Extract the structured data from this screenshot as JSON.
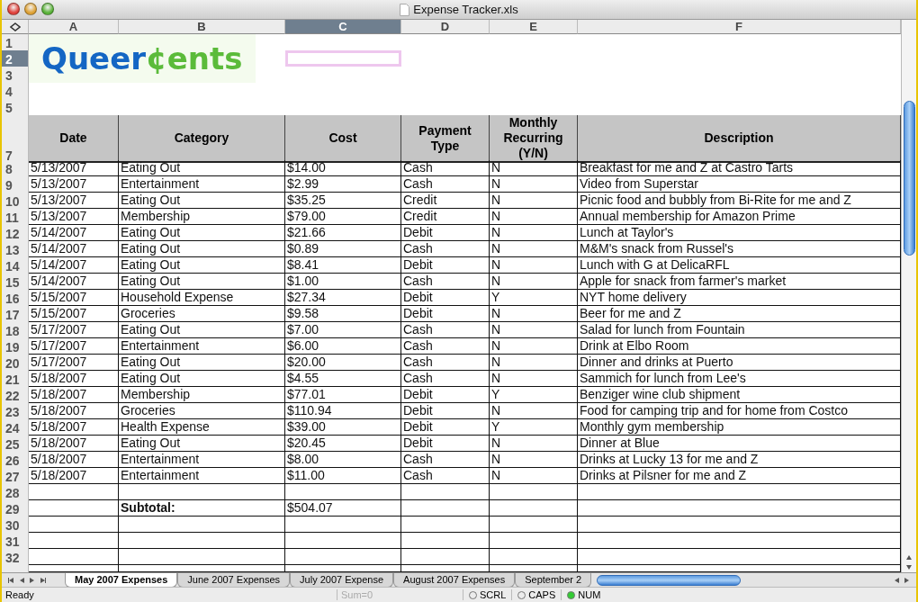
{
  "window": {
    "title": "Expense Tracker.xls"
  },
  "columns": [
    {
      "label": "A",
      "selected": false
    },
    {
      "label": "B",
      "selected": false
    },
    {
      "label": "C",
      "selected": true
    },
    {
      "label": "D",
      "selected": false
    },
    {
      "label": "E",
      "selected": false
    },
    {
      "label": "F",
      "selected": false
    }
  ],
  "logo": {
    "text_1": "Queer",
    "text_2": "¢ents"
  },
  "top_rows": [
    {
      "label": "1",
      "selected": false
    },
    {
      "label": "2",
      "selected": true
    },
    {
      "label": "3",
      "selected": false
    },
    {
      "label": "4",
      "selected": false
    },
    {
      "label": "5",
      "selected": false
    }
  ],
  "header_row": {
    "label": "7",
    "cells": [
      "Date",
      "Category",
      "Cost",
      "Payment Type",
      "Monthly Recurring (Y/N)",
      "Description"
    ]
  },
  "rows": [
    {
      "label": "8",
      "kind": "data",
      "cells": [
        "5/13/2007",
        "Eating Out",
        "$14.00",
        "Cash",
        "N",
        "Breakfast for me and Z at Castro Tarts"
      ]
    },
    {
      "label": "9",
      "kind": "data",
      "cells": [
        "5/13/2007",
        "Entertainment",
        "$2.99",
        "Cash",
        "N",
        "Video from Superstar"
      ]
    },
    {
      "label": "10",
      "kind": "data",
      "cells": [
        "5/13/2007",
        "Eating Out",
        "$35.25",
        "Credit",
        "N",
        "Picnic food and bubbly from Bi-Rite for me and Z"
      ]
    },
    {
      "label": "11",
      "kind": "data",
      "cells": [
        "5/13/2007",
        "Membership",
        "$79.00",
        "Credit",
        "N",
        "Annual membership for Amazon Prime"
      ]
    },
    {
      "label": "12",
      "kind": "data",
      "cells": [
        "5/14/2007",
        "Eating Out",
        "$21.66",
        "Debit",
        "N",
        "Lunch at Taylor's"
      ]
    },
    {
      "label": "13",
      "kind": "data",
      "cells": [
        "5/14/2007",
        "Eating Out",
        "$0.89",
        "Cash",
        "N",
        "M&M's snack from Russel's"
      ]
    },
    {
      "label": "14",
      "kind": "data",
      "cells": [
        "5/14/2007",
        "Eating Out",
        "$8.41",
        "Debit",
        "N",
        "Lunch with G at DelicaRFL"
      ]
    },
    {
      "label": "15",
      "kind": "data",
      "cells": [
        "5/14/2007",
        "Eating Out",
        "$1.00",
        "Cash",
        "N",
        "Apple for snack from farmer's market"
      ]
    },
    {
      "label": "16",
      "kind": "data",
      "cells": [
        "5/15/2007",
        "Household Expense",
        "$27.34",
        "Debit",
        "Y",
        "NYT home delivery"
      ]
    },
    {
      "label": "17",
      "kind": "data",
      "cells": [
        "5/15/2007",
        "Groceries",
        "$9.58",
        "Debit",
        "N",
        "Beer for me and Z"
      ]
    },
    {
      "label": "18",
      "kind": "data",
      "cells": [
        "5/17/2007",
        "Eating Out",
        "$7.00",
        "Cash",
        "N",
        "Salad for lunch from Fountain"
      ]
    },
    {
      "label": "19",
      "kind": "data",
      "cells": [
        "5/17/2007",
        "Entertainment",
        "$6.00",
        "Cash",
        "N",
        "Drink at Elbo Room"
      ]
    },
    {
      "label": "20",
      "kind": "data",
      "cells": [
        "5/17/2007",
        "Eating Out",
        "$20.00",
        "Cash",
        "N",
        "Dinner and drinks at Puerto"
      ]
    },
    {
      "label": "21",
      "kind": "data",
      "cells": [
        "5/18/2007",
        "Eating Out",
        "$4.55",
        "Cash",
        "N",
        "Sammich for lunch from Lee's"
      ]
    },
    {
      "label": "22",
      "kind": "data",
      "cells": [
        "5/18/2007",
        "Membership",
        "$77.01",
        "Debit",
        "Y",
        "Benziger wine club shipment"
      ]
    },
    {
      "label": "23",
      "kind": "data",
      "cells": [
        "5/18/2007",
        "Groceries",
        "$110.94",
        "Debit",
        "N",
        "Food for camping trip and for home from Costco"
      ]
    },
    {
      "label": "24",
      "kind": "data",
      "cells": [
        "5/18/2007",
        "Health Expense",
        "$39.00",
        "Debit",
        "Y",
        "Monthly gym membership"
      ]
    },
    {
      "label": "25",
      "kind": "data",
      "cells": [
        "5/18/2007",
        "Eating Out",
        "$20.45",
        "Debit",
        "N",
        "Dinner at Blue"
      ]
    },
    {
      "label": "26",
      "kind": "data",
      "cells": [
        "5/18/2007",
        "Entertainment",
        "$8.00",
        "Cash",
        "N",
        "Drinks at Lucky 13 for me and Z"
      ]
    },
    {
      "label": "27",
      "kind": "data",
      "cells": [
        "5/18/2007",
        "Entertainment",
        "$11.00",
        "Cash",
        "N",
        "Drinks at Pilsner for me and Z"
      ]
    },
    {
      "label": "28",
      "kind": "empty"
    },
    {
      "label": "29",
      "kind": "subtotal",
      "subtotal_label": "Subtotal:",
      "subtotal_value": "$504.07"
    },
    {
      "label": "30",
      "kind": "empty"
    },
    {
      "label": "31",
      "kind": "empty"
    },
    {
      "label": "32",
      "kind": "empty"
    }
  ],
  "sheet_tabs": [
    {
      "label": "May 2007 Expenses",
      "selected": true
    },
    {
      "label": "June 2007 Expenses",
      "selected": false
    },
    {
      "label": "July 2007 Expense",
      "selected": false
    },
    {
      "label": "August 2007 Expenses",
      "selected": false
    },
    {
      "label": "September 2",
      "selected": false
    }
  ],
  "status_bar": {
    "text": "Ready",
    "sum": "Sum=0",
    "indicators": [
      {
        "label": "SCRL",
        "on": false
      },
      {
        "label": "CAPS",
        "on": false
      },
      {
        "label": "NUM",
        "on": true
      }
    ]
  }
}
